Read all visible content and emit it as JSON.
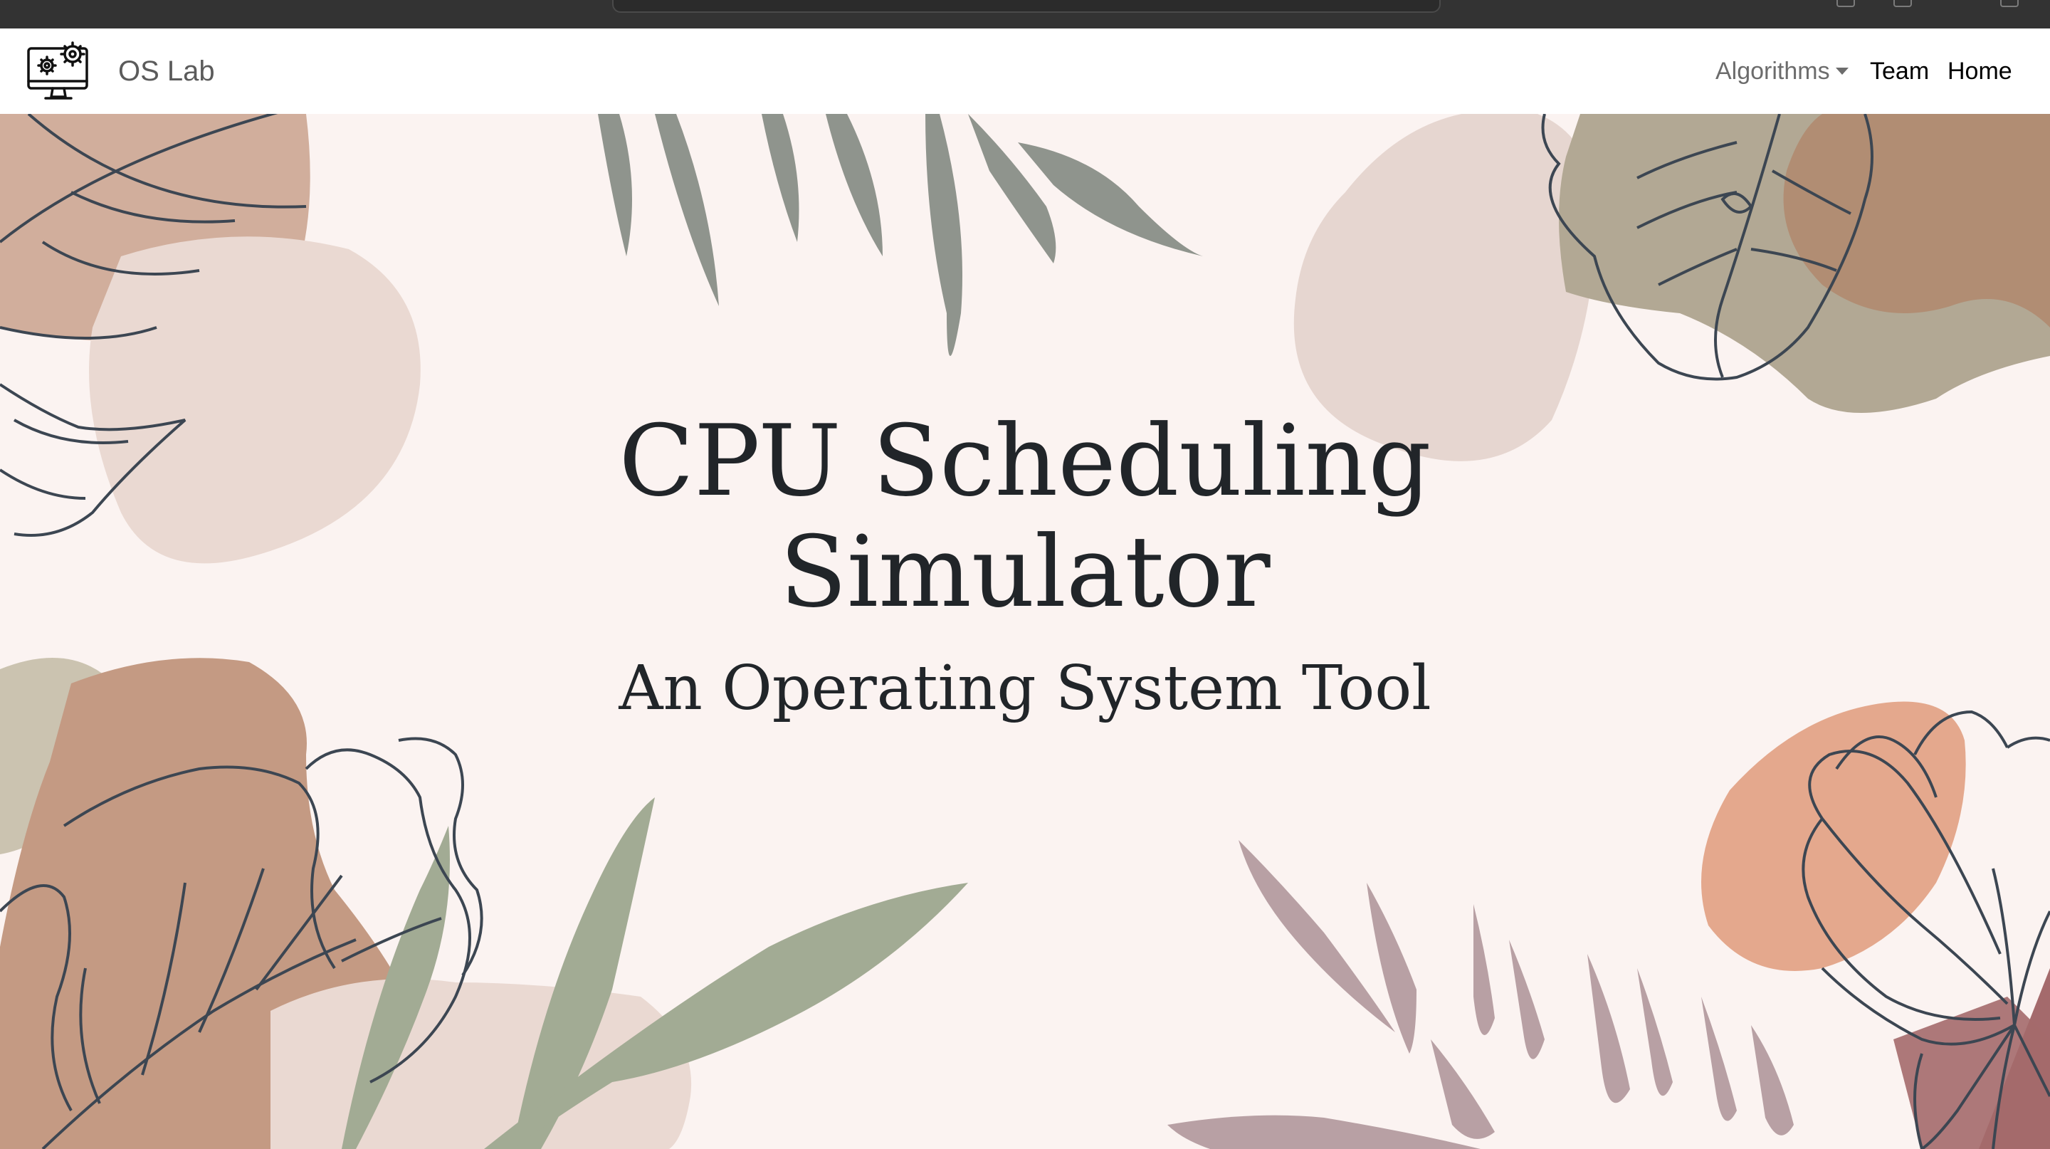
{
  "navbar": {
    "brand": "OS Lab",
    "logo_icon": "computer-gears-icon",
    "items": [
      {
        "label": "Algorithms",
        "has_dropdown": true
      },
      {
        "label": "Team"
      },
      {
        "label": "Home"
      }
    ]
  },
  "hero": {
    "title_line1": "CPU Scheduling",
    "title_line2": "Simulator",
    "subtitle": "An Operating System Tool"
  },
  "colors": {
    "background": "#fbf3f1",
    "navbar": "#ffffff",
    "text": "#212529",
    "sage": "#a2ab94",
    "terracotta": "#c49a83",
    "peach": "#e4a88d",
    "mauve": "#b8a0a4",
    "line_art": "#3c4652"
  }
}
